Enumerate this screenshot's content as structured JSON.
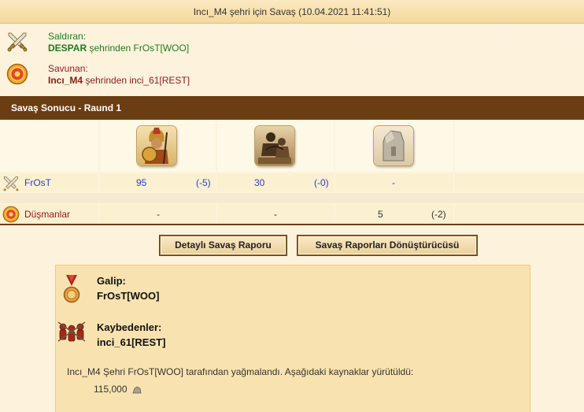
{
  "title": "Incı_M4 şehri için Savaş (10.04.2021 11:41:51)",
  "attacker": {
    "role": "Saldıran:",
    "city": "DESPAR",
    "from_text": "şehrinden FrOsT[WOO]",
    "icon": "crossed-swords-icon"
  },
  "defender": {
    "role": "Savunan:",
    "city": "Incı_M4",
    "from_text": "şehrinden inci_61[REST]",
    "icon": "shield-icon"
  },
  "result_header": "Savaş Sonucu - Raund 1",
  "units": [
    "hoplite-unit-icon",
    "archer-unit-icon",
    "wall-unit-icon"
  ],
  "rows": [
    {
      "label": "FrOsT",
      "icon": "crossed-swords-icon",
      "color": "#2a3fc7",
      "cells": [
        {
          "count": "95",
          "loss": "(-5)"
        },
        {
          "count": "30",
          "loss": "(-0)"
        },
        {
          "count": "-",
          "loss": ""
        }
      ]
    },
    {
      "label": "Düşmanlar",
      "icon": "shield-icon",
      "color": "#8b1a1a",
      "cells": [
        {
          "count": "-",
          "loss": ""
        },
        {
          "count": "-",
          "loss": ""
        },
        {
          "count": "5",
          "loss": "(-2)"
        }
      ]
    }
  ],
  "buttons": {
    "detailed": "Detaylı Savaş Raporu",
    "converter": "Savaş Raporları Dönüştürücüsü"
  },
  "summary": {
    "winner_label": "Galip:",
    "winner": "FrOsT[WOO]",
    "losers_label": "Kaybedenler:",
    "losers": "inci_61[REST]",
    "message": "Incı_M4 Şehri FrOsT[WOO] tarafından yağmalandı. Aşağıdaki kaynaklar yürütüldü:",
    "loot_amount": "115,000",
    "loot_icon": "stone-resource-icon"
  },
  "colors": {
    "header_brown": "#6b3d12",
    "attacker_green": "#1e7a1e",
    "defender_red": "#8b1a1a",
    "unit_blue": "#2a3fc7"
  }
}
